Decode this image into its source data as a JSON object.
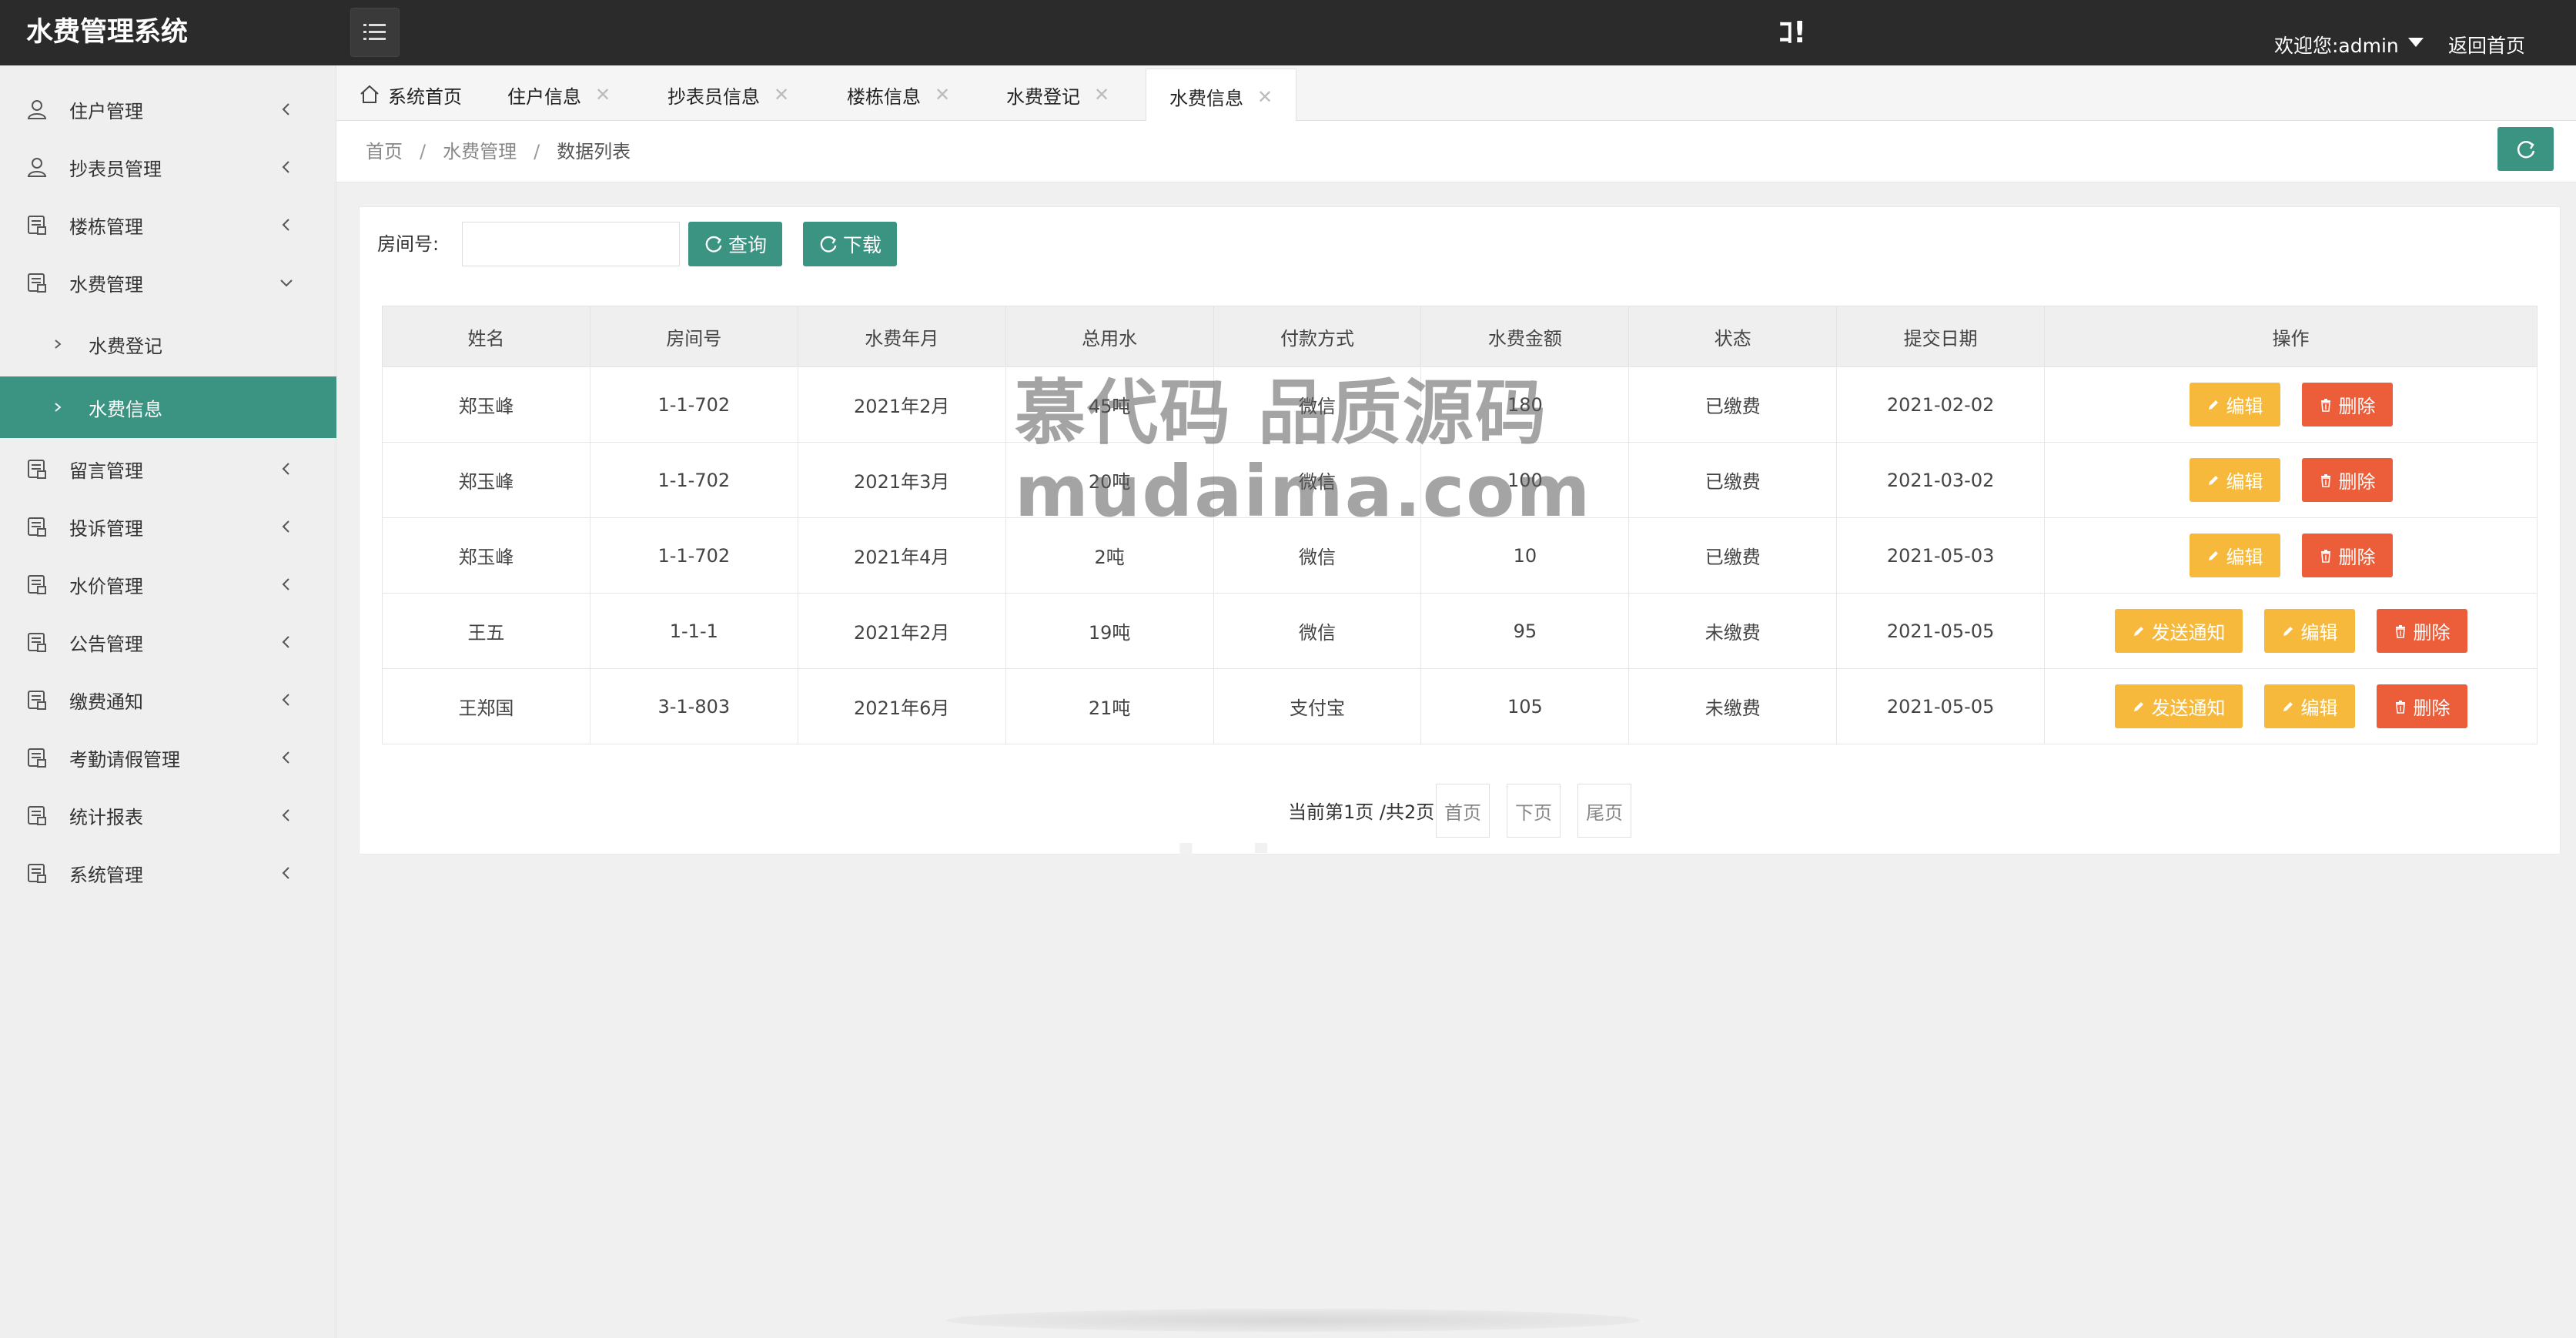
{
  "app": {
    "brand": "水费管理系统",
    "top_glyph": "ｺ!",
    "welcome": "欢迎您:admin",
    "back_home": "返回首页"
  },
  "sidebar": {
    "items": [
      {
        "label": "住户管理",
        "icon": "user-icon"
      },
      {
        "label": "抄表员管理",
        "icon": "user-icon"
      },
      {
        "label": "楼栋管理",
        "icon": "form-icon"
      },
      {
        "label": "水费管理",
        "icon": "form-icon",
        "expanded": true
      },
      {
        "label": "留言管理",
        "icon": "form-icon"
      },
      {
        "label": "投诉管理",
        "icon": "form-icon"
      },
      {
        "label": "水价管理",
        "icon": "form-icon"
      },
      {
        "label": "公告管理",
        "icon": "form-icon"
      },
      {
        "label": "缴费通知",
        "icon": "form-icon"
      },
      {
        "label": "考勤请假管理",
        "icon": "form-icon"
      },
      {
        "label": "统计报表",
        "icon": "form-icon"
      },
      {
        "label": "系统管理",
        "icon": "form-icon"
      }
    ],
    "subitems": [
      {
        "label": "水费登记",
        "active": false
      },
      {
        "label": "水费信息",
        "active": true
      }
    ]
  },
  "tabs": [
    {
      "label": "系统首页",
      "closable": false
    },
    {
      "label": "住户信息",
      "closable": true
    },
    {
      "label": "抄表员信息",
      "closable": true
    },
    {
      "label": "楼栋信息",
      "closable": true
    },
    {
      "label": "水费登记",
      "closable": true
    },
    {
      "label": "水费信息",
      "closable": true,
      "active": true
    }
  ],
  "breadcrumb": [
    "首页",
    "水费管理",
    "数据列表"
  ],
  "search": {
    "label": "房间号:",
    "value": "",
    "placeholder": "",
    "query_label": "查询",
    "download_label": "下载"
  },
  "table": {
    "headers": [
      "姓名",
      "房间号",
      "水费年月",
      "总用水",
      "付款方式",
      "水费金额",
      "状态",
      "提交日期",
      "操作"
    ],
    "rows": [
      {
        "name": "郑玉峰",
        "room": "1-1-702",
        "month": "2021年2月",
        "usage": "45吨",
        "pay": "微信",
        "amount": "180",
        "status": "已缴费",
        "date": "2021-02-02",
        "notify": false
      },
      {
        "name": "郑玉峰",
        "room": "1-1-702",
        "month": "2021年3月",
        "usage": "20吨",
        "pay": "微信",
        "amount": "100",
        "status": "已缴费",
        "date": "2021-03-02",
        "notify": false
      },
      {
        "name": "郑玉峰",
        "room": "1-1-702",
        "month": "2021年4月",
        "usage": "2吨",
        "pay": "微信",
        "amount": "10",
        "status": "已缴费",
        "date": "2021-05-03",
        "notify": false
      },
      {
        "name": "王五",
        "room": "1-1-1",
        "month": "2021年2月",
        "usage": "19吨",
        "pay": "微信",
        "amount": "95",
        "status": "未缴费",
        "date": "2021-05-05",
        "notify": true
      },
      {
        "name": "王郑国",
        "room": "3-1-803",
        "month": "2021年6月",
        "usage": "21吨",
        "pay": "支付宝",
        "amount": "105",
        "status": "未缴费",
        "date": "2021-05-05",
        "notify": true
      }
    ],
    "actions": {
      "notify": "发送通知",
      "edit": "编辑",
      "delete": "删除"
    }
  },
  "pager": {
    "info": "当前第1页 /共2页",
    "first": "首页",
    "next": "下页",
    "last": "尾页"
  },
  "watermark": {
    "line1": "慕代码 品质源码",
    "line2": "mudaima.com"
  },
  "colors": {
    "accent": "#3b9382",
    "topbar": "#2b2b2b",
    "edit": "#f6b93b",
    "delete": "#ec5d3a"
  }
}
